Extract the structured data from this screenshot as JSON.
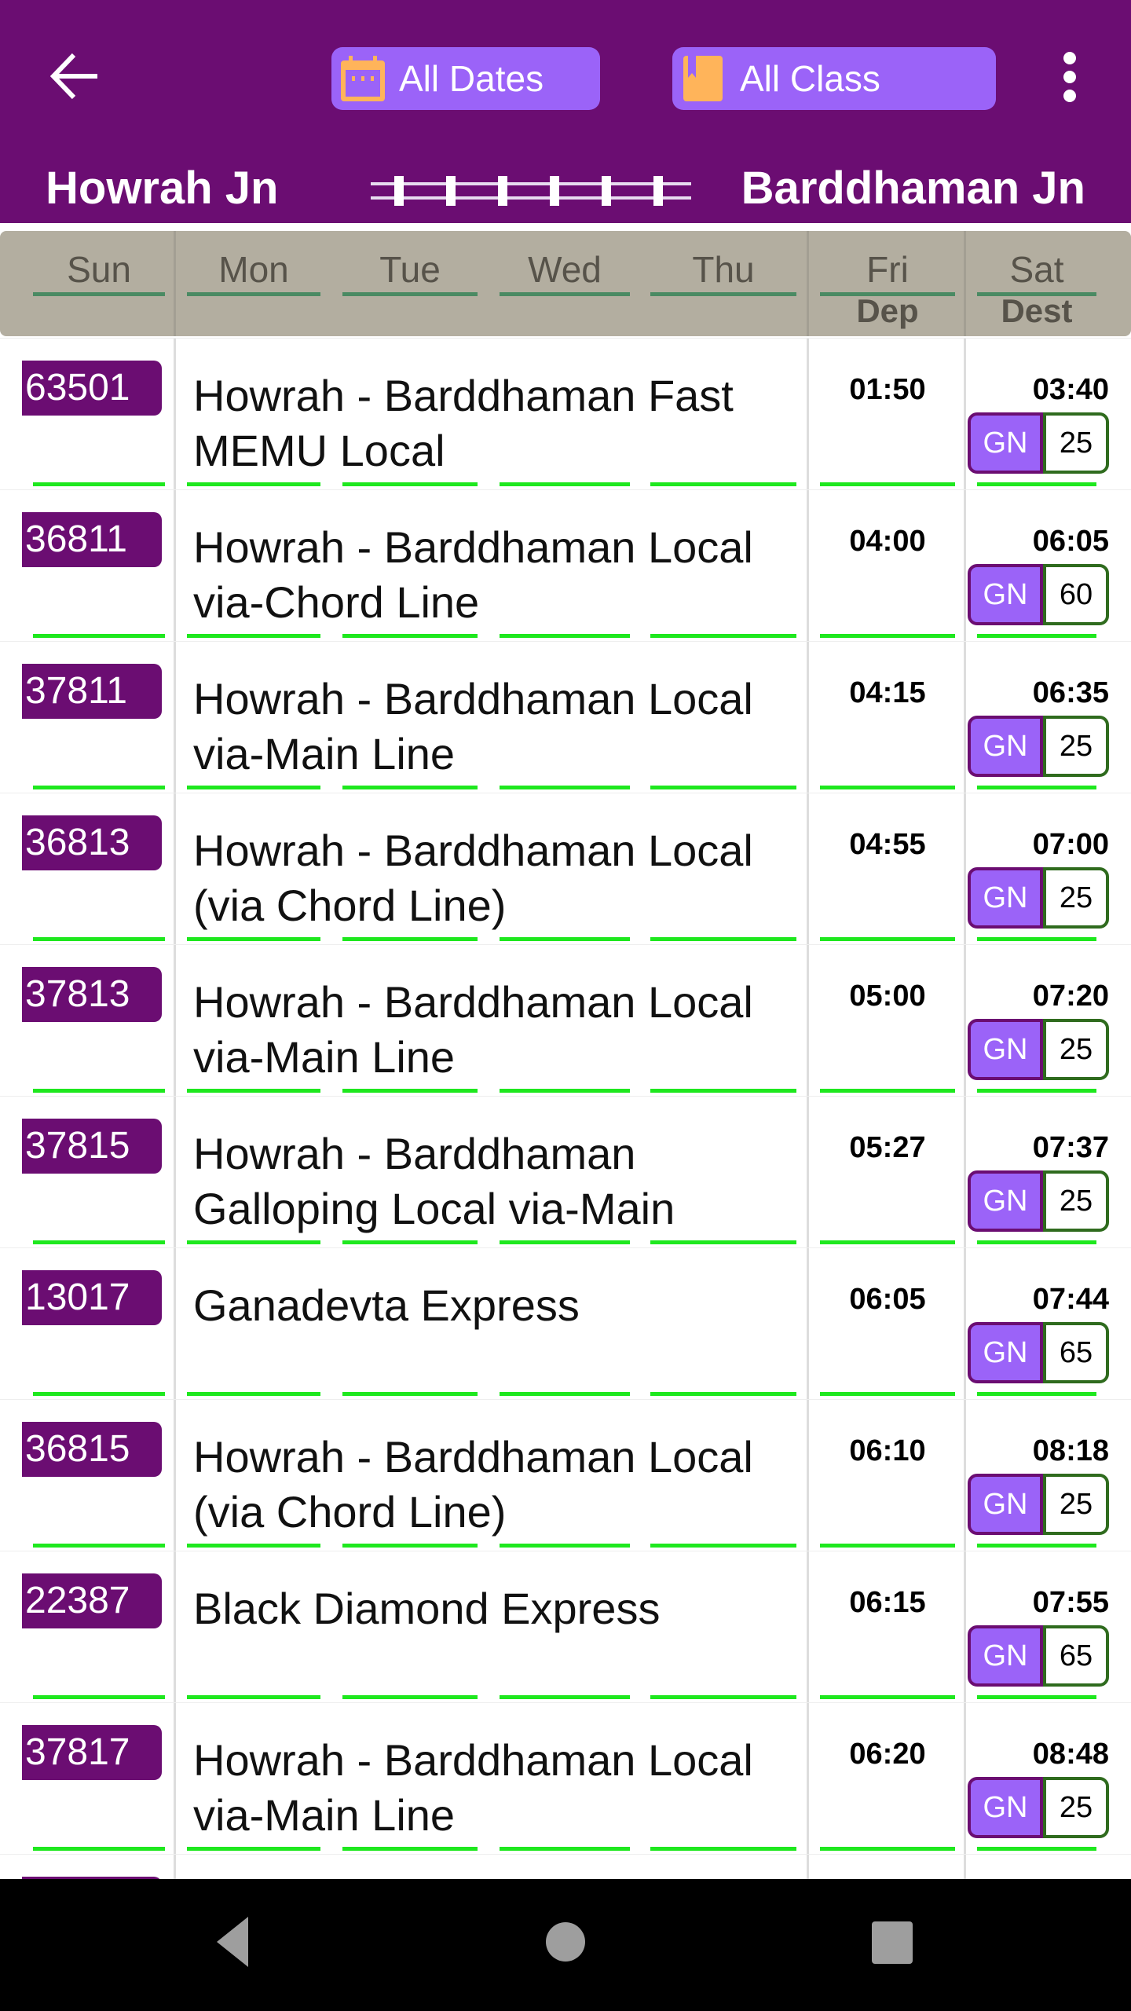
{
  "app_bar": {
    "back_icon": "arrow-left-icon",
    "date_filter": {
      "label": "All Dates",
      "icon": "calendar-icon"
    },
    "class_filter": {
      "label": "All Class",
      "icon": "bookmark-icon"
    },
    "menu_icon": "more-vertical-icon",
    "from_station": "Howrah Jn",
    "to_station": "Barddhaman Jn",
    "route_icon": "railway-track-icon"
  },
  "table_header": {
    "days": [
      "Sun",
      "Mon",
      "Tue",
      "Wed",
      "Thu",
      "Fri",
      "Sat"
    ],
    "dep_label": "Dep",
    "dest_label": "Dest"
  },
  "colors": {
    "primary": "#6b0d72",
    "chip": "#9b63f8",
    "chip_icon": "#ffb45a",
    "header_bg": "#b3aea0",
    "run_day_bar": "#1ee81e",
    "count_border": "#2f6b1e"
  },
  "trains": [
    {
      "number": "63501",
      "name": "Howrah - Barddhaman Fast MEMU Local",
      "dep": "01:50",
      "arr": "03:40",
      "class": "GN",
      "count": "25"
    },
    {
      "number": "36811",
      "name": "Howrah - Barddhaman Local via-Chord Line",
      "dep": "04:00",
      "arr": "06:05",
      "class": "GN",
      "count": "60"
    },
    {
      "number": "37811",
      "name": "Howrah - Barddhaman Local via-Main Line",
      "dep": "04:15",
      "arr": "06:35",
      "class": "GN",
      "count": "25"
    },
    {
      "number": "36813",
      "name": "Howrah - Barddhaman Local (via Chord Line)",
      "dep": "04:55",
      "arr": "07:00",
      "class": "GN",
      "count": "25"
    },
    {
      "number": "37813",
      "name": "Howrah - Barddhaman Local via-Main Line",
      "dep": "05:00",
      "arr": "07:20",
      "class": "GN",
      "count": "25"
    },
    {
      "number": "37815",
      "name": "Howrah - Barddhaman Galloping Local via-Main",
      "dep": "05:27",
      "arr": "07:37",
      "class": "GN",
      "count": "25"
    },
    {
      "number": "13017",
      "name": "Ganadevta Express",
      "dep": "06:05",
      "arr": "07:44",
      "class": "GN",
      "count": "65"
    },
    {
      "number": "36815",
      "name": "Howrah - Barddhaman Local (via Chord Line)",
      "dep": "06:10",
      "arr": "08:18",
      "class": "GN",
      "count": "25"
    },
    {
      "number": "22387",
      "name": "Black Diamond Express",
      "dep": "06:15",
      "arr": "07:55",
      "class": "GN",
      "count": "65"
    },
    {
      "number": "37817",
      "name": "Howrah - Barddhaman Local via-Main Line",
      "dep": "06:20",
      "arr": "08:48",
      "class": "GN",
      "count": "25"
    }
  ],
  "nav_bar": {
    "back": "nav-back-icon",
    "home": "nav-home-icon",
    "recents": "nav-recents-icon"
  }
}
